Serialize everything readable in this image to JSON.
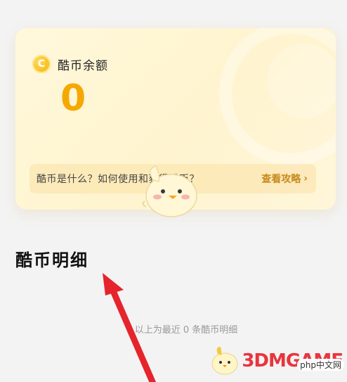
{
  "card": {
    "balance_title": "酷币余额",
    "coin_glyph": "C",
    "amount": "0",
    "info_text": "酷币是什么？如何使用和获得酷币？",
    "guide_label": "查看攻略",
    "guide_chevron": "›"
  },
  "section": {
    "title": "酷币明细",
    "empty_note": "以上为最近 0 条酷币明细"
  },
  "watermark": {
    "brand": "3DMGAME",
    "site": "php中文网"
  },
  "colors": {
    "accent": "#f5a800",
    "link": "#c8891c",
    "arrow": "#e5242b",
    "watermark": "#e8353d"
  },
  "icons": [
    "coin-icon",
    "chevron-right-icon",
    "mascot-chick-icon",
    "red-arrow-annotation"
  ]
}
